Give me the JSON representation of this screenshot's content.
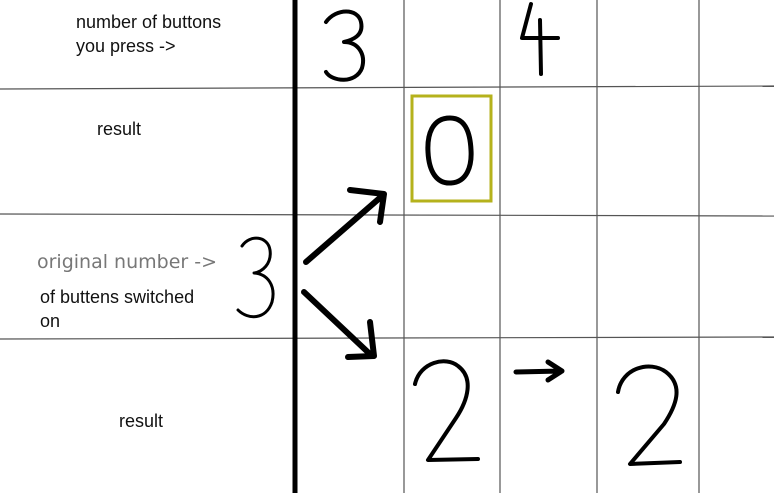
{
  "labels": {
    "buttons_line1": "number of buttons",
    "buttons_line2": "you press ->",
    "result_top": "result",
    "original_line1": "original number ->",
    "original_line2": "of buttens switched",
    "original_line3": "on",
    "result_bottom": "result"
  },
  "digits": {
    "pressed_a": "3",
    "pressed_b": "4",
    "original": "3",
    "result_top": "0",
    "result_bottom_a": "2",
    "result_bottom_b": "2"
  },
  "colors": {
    "grid": "#555555",
    "axis": "#000000",
    "highlight": "#b5b21c",
    "ink": "#000000"
  }
}
